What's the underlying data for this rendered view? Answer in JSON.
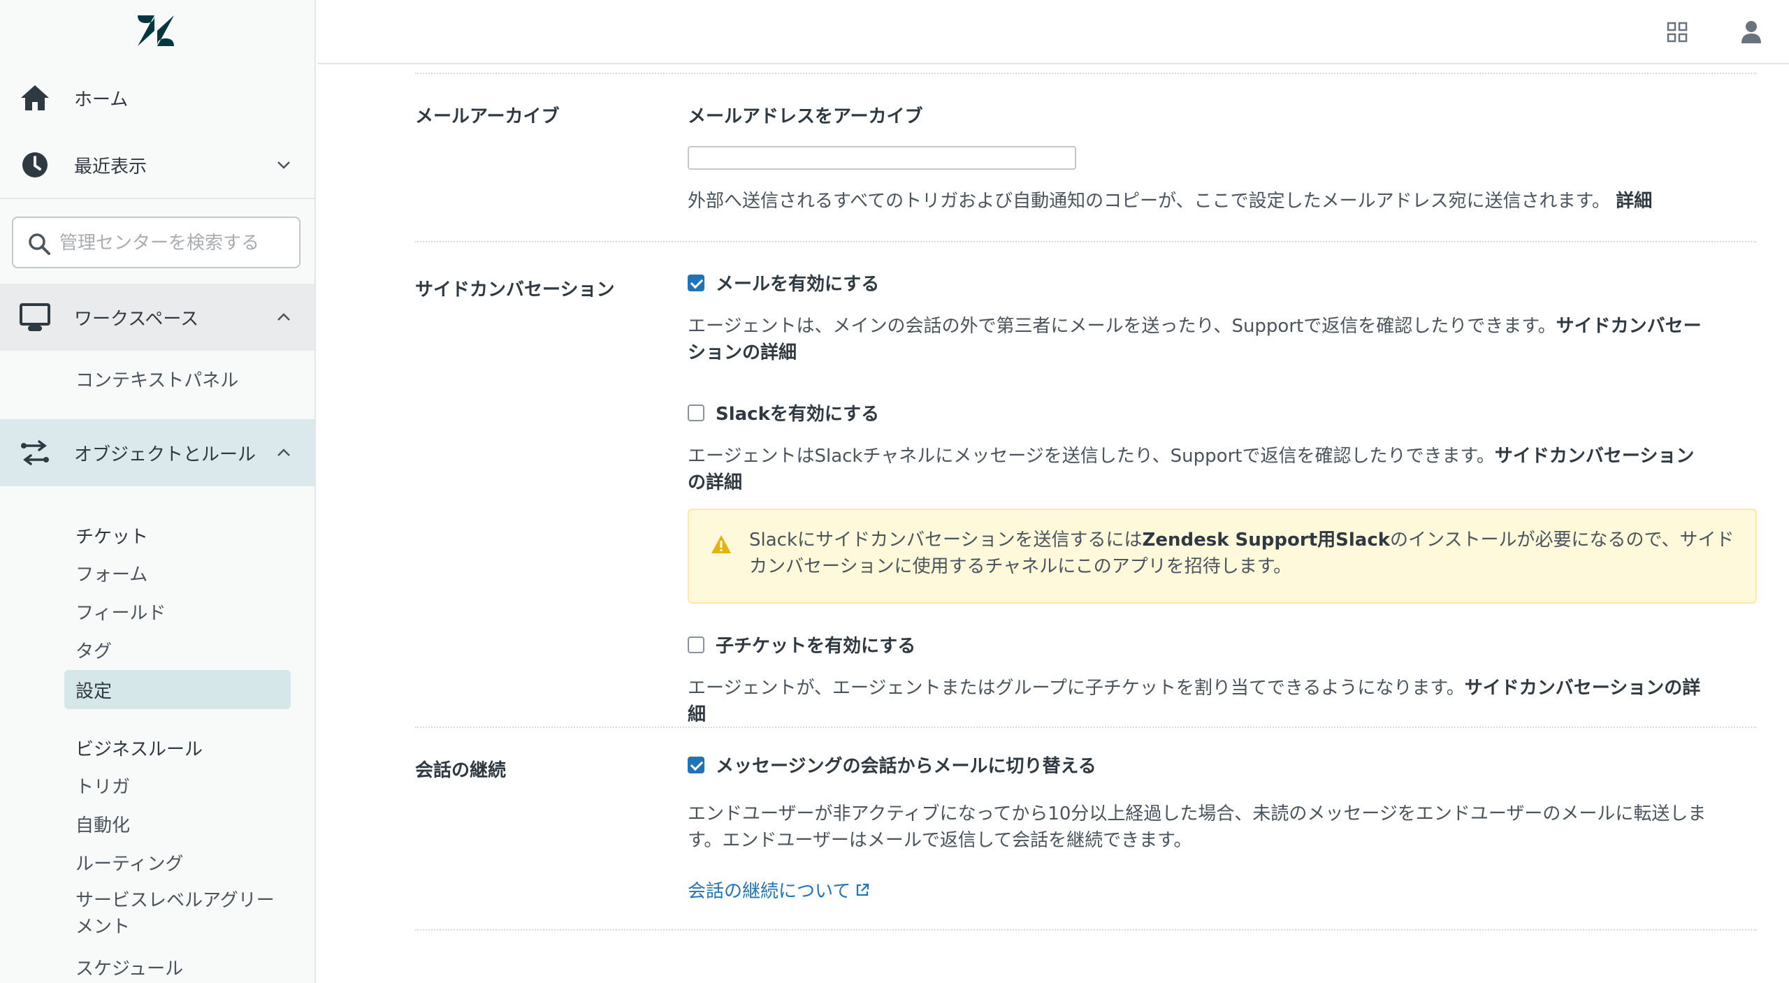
{
  "sidebar": {
    "home_label": "ホーム",
    "recent_label": "最近表示",
    "search_placeholder": "管理センターを検索する",
    "workspace_label": "ワークスペース",
    "workspace_items": [
      "コンテキストパネル"
    ],
    "objects_label": "オブジェクトとルール",
    "tickets_heading": "チケット",
    "ticket_items": [
      "フォーム",
      "フィールド",
      "タグ",
      "設定"
    ],
    "selected_item": "設定",
    "business_rules_heading": "ビジネスルール",
    "business_rules_items": [
      "トリガ",
      "自動化",
      "ルーティング",
      "サービスレベルアグリーメント",
      "スケジュール"
    ]
  },
  "topbar": {
    "apps_icon": "grid-icon",
    "user_icon": "user-icon"
  },
  "main": {
    "mail_archive": {
      "section_label": "メールアーカイブ",
      "field_title": "メールアドレスをアーカイブ",
      "input_value": "",
      "description": "外部へ送信されるすべてのトリガおよび自動通知のコピーが、ここで設定したメールアドレス宛に送信されます。",
      "detail_link": "詳細"
    },
    "side_conversation": {
      "section_label": "サイドカンバセーション",
      "email": {
        "label": "メールを有効にする",
        "checked": true,
        "description": "エージェントは、メインの会話の外で第三者にメールを送ったり、Supportで返信を確認したりできます。",
        "detail_link": "サイドカンバセーションの詳細"
      },
      "slack": {
        "label": "Slackを有効にする",
        "checked": false,
        "description": "エージェントはSlackチャネルにメッセージを送信したり、Supportで返信を確認したりできます。",
        "detail_link": "サイドカンバセーションの詳細"
      },
      "alert": {
        "icon": "warning-icon",
        "text_before": "Slackにサイドカンバセーションを送信するには",
        "text_bold": "Zendesk Support用Slack",
        "text_after": "のインストールが必要になるので、サイドカンバセーションに使用するチャネルにこのアプリを招待します。"
      },
      "child_ticket": {
        "label": "子チケットを有効にする",
        "checked": false,
        "description": "エージェントが、エージェントまたはグループに子チケットを割り当てできるようになります。",
        "detail_link": "サイドカンバセーションの詳細"
      }
    },
    "continuation": {
      "section_label": "会話の継続",
      "label": "メッセージングの会話からメールに切り替える",
      "checked": true,
      "description": "エンドユーザーが非アクティブになってから10分以上経過した場合、未読のメッセージをエンドユーザーのメールに転送します。エンドユーザーはメールで返信して会話を継続できます。",
      "link": "会話の継続について"
    }
  },
  "colors": {
    "accent": "#1f73b7",
    "sidebar_active": "#dbe8ec",
    "alert_bg": "#fff9db",
    "alert_icon": "#e3b40d"
  }
}
